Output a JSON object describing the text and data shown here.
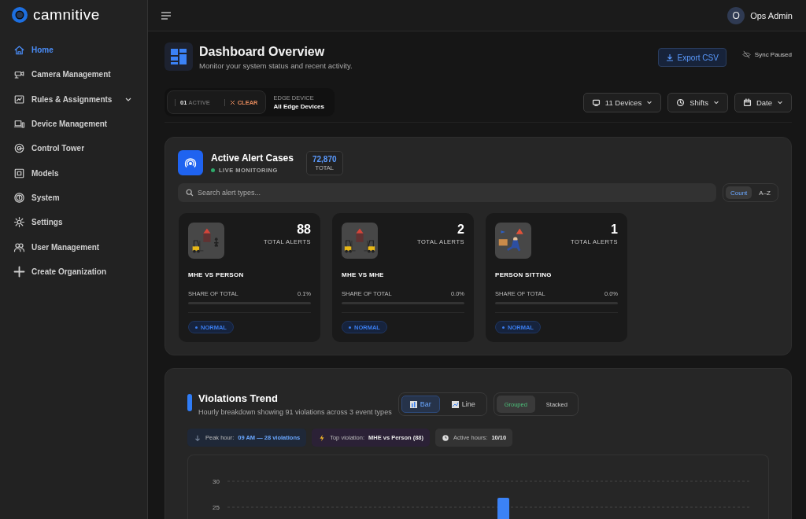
{
  "brand": {
    "name": "camnitive"
  },
  "sidebar": {
    "items": [
      {
        "label": "Home",
        "kind": "link",
        "selected": true
      },
      {
        "label": "Camera Management",
        "kind": "link",
        "selected": false
      },
      {
        "label": "Rules & Assignments",
        "kind": "group",
        "selected": false,
        "expanded": false
      },
      {
        "label": "Device Management",
        "kind": "link",
        "selected": false
      },
      {
        "label": "Control Tower",
        "kind": "link",
        "selected": false
      },
      {
        "label": "Models",
        "kind": "link",
        "selected": false
      },
      {
        "label": "System",
        "kind": "link",
        "selected": false
      },
      {
        "label": "Settings",
        "kind": "link",
        "selected": false
      },
      {
        "label": "User Management",
        "kind": "link",
        "selected": false
      },
      {
        "label": "Create Organization",
        "kind": "link",
        "selected": false
      }
    ]
  },
  "topbar": {
    "user": {
      "initial": "O",
      "name": "Ops Admin"
    }
  },
  "header": {
    "title": "Dashboard Overview",
    "subtitle": "Monitor your system status and recent activity.",
    "export_button": "Export CSV",
    "sync_status": "Sync Paused"
  },
  "filters": {
    "active_count": "01",
    "active_label": "ACTIVE",
    "clear_label": "CLEAR",
    "edge_device": {
      "label": "EDGE DEVICE",
      "value": "All Edge Devices"
    },
    "dropdowns": [
      {
        "label": "11 Devices",
        "kind": "devices"
      },
      {
        "label": "Shifts",
        "kind": "shifts"
      },
      {
        "label": "Date",
        "kind": "date"
      }
    ]
  },
  "alerts": {
    "title": "Active Alert Cases",
    "live_label": "LIVE MONITORING",
    "total": "72,870",
    "total_label": "TOTAL",
    "search": {
      "placeholder": "Search alert types..."
    },
    "sort_options": [
      {
        "label": "Count",
        "selected": true
      },
      {
        "label": "A–Z",
        "selected": false
      }
    ],
    "cards": [
      {
        "kind": "mhe_person",
        "count": "88",
        "count_label": "TOTAL ALERTS",
        "name": "MHE VS PERSON",
        "share_label": "SHARE OF TOTAL",
        "share": "0.1%",
        "status": "NORMAL"
      },
      {
        "kind": "mhe_mhe",
        "count": "2",
        "count_label": "TOTAL ALERTS",
        "name": "MHE VS MHE",
        "share_label": "SHARE OF TOTAL",
        "share": "0.0%",
        "status": "NORMAL"
      },
      {
        "kind": "person_sitting",
        "count": "1",
        "count_label": "TOTAL ALERTS",
        "name": "PERSON SITTING",
        "share_label": "SHARE OF TOTAL",
        "share": "0.0%",
        "status": "NORMAL"
      }
    ]
  },
  "trend": {
    "title": "Violations Trend",
    "subtitle": "Hourly breakdown showing 91 violations across 3 event types",
    "chart_types": [
      {
        "label": "Bar",
        "selected": true
      },
      {
        "label": "Line",
        "selected": false
      }
    ],
    "modes": [
      {
        "label": "Grouped",
        "selected": true
      },
      {
        "label": "Stacked",
        "selected": false
      }
    ],
    "chips": [
      {
        "kind": "peak",
        "label": "Peak hour:",
        "value": "09 AM — 28 violations"
      },
      {
        "kind": "top",
        "label": "Top violation:",
        "value": "MHE vs Person (88)"
      },
      {
        "kind": "active",
        "label": "Active hours:",
        "value": "10/10"
      }
    ],
    "chart": {
      "y_tick_labels": [
        "30",
        "25"
      ]
    }
  }
}
